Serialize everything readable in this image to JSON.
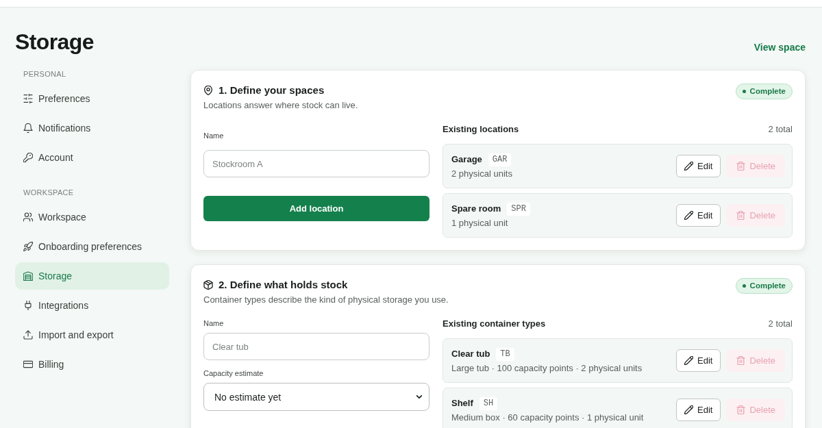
{
  "header": {
    "title": "Storage",
    "link": "View space"
  },
  "sidebar": {
    "sections": [
      {
        "label": "PERSONAL",
        "items": [
          {
            "label": "Preferences",
            "selected": false
          },
          {
            "label": "Notifications",
            "selected": false
          },
          {
            "label": "Account",
            "selected": false
          }
        ]
      },
      {
        "label": "WORKSPACE",
        "items": [
          {
            "label": "Workspace",
            "selected": false
          },
          {
            "label": "Onboarding preferences",
            "selected": false
          },
          {
            "label": "Storage",
            "selected": true
          },
          {
            "label": "Integrations",
            "selected": false
          },
          {
            "label": "Import and export",
            "selected": false
          },
          {
            "label": "Billing",
            "selected": false
          }
        ]
      }
    ]
  },
  "cards": [
    {
      "title": "1. Define your spaces",
      "subtitle": "Locations answer where stock can live.",
      "status": {
        "label": "Complete",
        "complete": true
      },
      "form": {
        "fields": [
          {
            "kind": "text",
            "label": "Name",
            "placeholder": "Stockroom A"
          }
        ],
        "button": "Add location"
      },
      "list": {
        "title": "Existing locations",
        "count": "2 total",
        "items": [
          {
            "name": "Garage",
            "code": "GAR",
            "detail": "2 physical units",
            "actions": [
              {
                "kind": "edit",
                "label": "Edit",
                "disabled": false
              },
              {
                "kind": "delete",
                "label": "Delete",
                "disabled": true
              }
            ]
          },
          {
            "name": "Spare room",
            "code": "SPR",
            "detail": "1 physical unit",
            "actions": [
              {
                "kind": "edit",
                "label": "Edit",
                "disabled": false
              },
              {
                "kind": "delete",
                "label": "Delete",
                "disabled": true
              }
            ]
          }
        ]
      }
    },
    {
      "title": "2. Define what holds stock",
      "subtitle": "Container types describe the kind of physical storage you use.",
      "status": {
        "label": "Complete",
        "complete": true
      },
      "form": {
        "fields": [
          {
            "kind": "text",
            "label": "Name",
            "placeholder": "Clear tub"
          },
          {
            "kind": "select",
            "label": "Capacity estimate",
            "value": "No estimate yet"
          }
        ]
      },
      "list": {
        "title": "Existing container types",
        "count": "2 total",
        "items": [
          {
            "name": "Clear tub",
            "code": "TB",
            "detail": "Large tub · 100 capacity points · 2 physical units",
            "actions": [
              {
                "kind": "edit",
                "label": "Edit",
                "disabled": false
              },
              {
                "kind": "delete",
                "label": "Delete",
                "disabled": true
              }
            ]
          },
          {
            "name": "Shelf",
            "code": "SH",
            "detail": "Medium box · 60 capacity points · 1 physical unit",
            "actions": [
              {
                "kind": "edit",
                "label": "Edit",
                "disabled": false
              },
              {
                "kind": "delete",
                "label": "Delete",
                "disabled": true
              }
            ]
          }
        ]
      }
    }
  ]
}
